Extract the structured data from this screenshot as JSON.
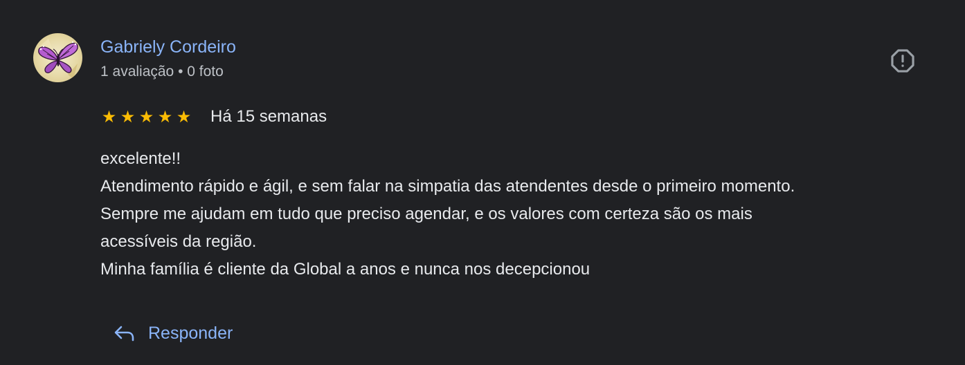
{
  "author": {
    "name": "Gabriely Cordeiro",
    "meta": "1 avaliação • 0 foto",
    "avatar_icon": "butterfly-avatar"
  },
  "flag_icon": "report-icon",
  "review": {
    "stars": 5,
    "max_stars": 5,
    "date": "Há 15 semanas",
    "lines": [
      "excelente!!",
      "Atendimento rápido e ágil, e sem falar na simpatia das atendentes desde o primeiro momento.",
      "Sempre me ajudam em tudo que preciso agendar, e os valores com certeza são os mais",
      "acessíveis da região.",
      "Minha família é cliente da Global a anos e nunca nos decepcionou"
    ]
  },
  "reply": {
    "label": "Responder",
    "icon": "reply-arrow-icon"
  },
  "colors": {
    "background": "#202124",
    "link": "#8ab4f8",
    "star": "#fbbc04",
    "text": "#e8eaed",
    "secondary_text": "#bdc1c6"
  }
}
